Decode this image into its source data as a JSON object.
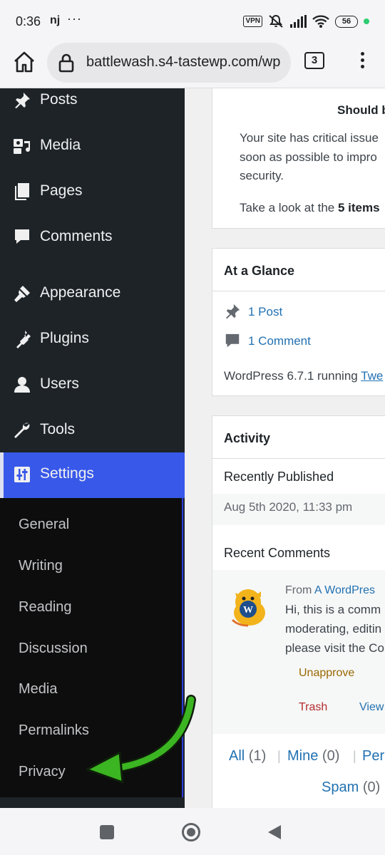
{
  "status_bar": {
    "time": "0:36",
    "carrier_tag": "nj",
    "more": "···",
    "vpn_label": "VPN",
    "battery": "56"
  },
  "browser": {
    "url": "battlewash.s4-tastewp.com/wp",
    "tab_count": "3"
  },
  "sidebar": {
    "items": [
      {
        "label": "Posts",
        "icon": "pin-icon"
      },
      {
        "label": "Media",
        "icon": "media-icon"
      },
      {
        "label": "Pages",
        "icon": "pages-icon"
      },
      {
        "label": "Comments",
        "icon": "comment-icon"
      },
      {
        "label": "Appearance",
        "icon": "brush-icon"
      },
      {
        "label": "Plugins",
        "icon": "plug-icon"
      },
      {
        "label": "Users",
        "icon": "user-icon"
      },
      {
        "label": "Tools",
        "icon": "wrench-icon"
      },
      {
        "label": "Settings",
        "icon": "settings-icon"
      }
    ],
    "submenu": [
      "General",
      "Writing",
      "Reading",
      "Discussion",
      "Media",
      "Permalinks",
      "Privacy"
    ]
  },
  "health_card": {
    "heading": "Should b",
    "line1": "Your site has critical issue",
    "line2": "soon as possible to impro",
    "line3": "security.",
    "look_prefix": "Take a look at the ",
    "look_bold": "5 items"
  },
  "glance": {
    "title": "At a Glance",
    "posts": "1 Post",
    "comments": "1 Comment",
    "running": "WordPress 6.7.1 running ",
    "theme_link": "Twe"
  },
  "activity": {
    "title": "Activity",
    "recently_published": "Recently Published",
    "post_date": "Aug 5th 2020, 11:33 pm",
    "recent_comments": "Recent Comments",
    "from_prefix": "From ",
    "from_author": "A WordPres",
    "comment_l1": "Hi, this is a comm",
    "comment_l2": "moderating, editin",
    "comment_l3": "please visit the Co",
    "unapprove": "Unapprove",
    "trash": "Trash",
    "view": "View",
    "filter_all": "All",
    "filter_all_count": "(1)",
    "filter_mine": "Mine",
    "filter_mine_count": "(0)",
    "filter_pending": "Per",
    "filter_spam": "Spam",
    "filter_spam_count": "(0)",
    "sep": "|"
  },
  "colors": {
    "accent": "#3858e9",
    "sidebar_bg": "#1d2327",
    "link": "#2271b1",
    "arrow": "#3bb521"
  }
}
